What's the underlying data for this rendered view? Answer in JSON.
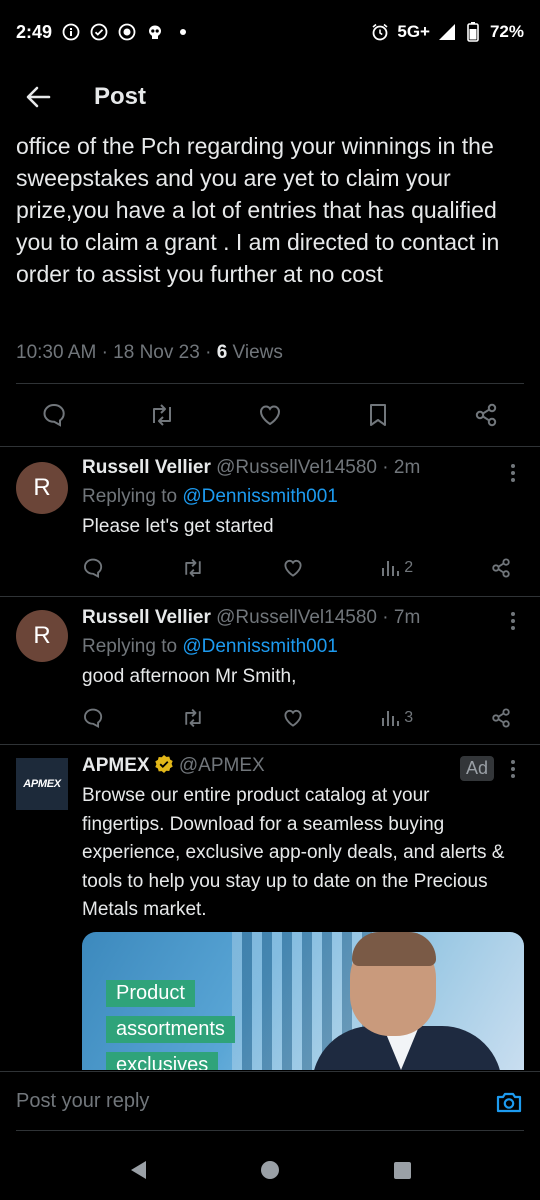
{
  "status_bar": {
    "time": "2:49",
    "network": "5G+",
    "battery": "72%"
  },
  "header": {
    "title": "Post"
  },
  "post": {
    "text": "office of the Pch regarding your winnings in the sweepstakes and you are yet to claim your prize,you have a lot of entries that has qualified you to claim a grant . I am directed to contact in order to assist you further at no cost",
    "time": "10:30 AM",
    "date": "18 Nov 23",
    "views_count": "6",
    "views_label": "Views"
  },
  "replies": [
    {
      "avatar_letter": "R",
      "name": "Russell Vellier",
      "handle": "@RussellVel14580",
      "time": "2m",
      "replying_prefix": "Replying to",
      "replying_to": "@Dennissmith001",
      "text": "Please let's get started",
      "views": "2"
    },
    {
      "avatar_letter": "R",
      "name": "Russell Vellier",
      "handle": "@RussellVel14580",
      "time": "7m",
      "replying_prefix": "Replying to",
      "replying_to": "@Dennissmith001",
      "text": "good afternoon Mr Smith,",
      "views": "3"
    }
  ],
  "ad": {
    "logo_text": "APMEX",
    "name": "APMEX",
    "handle": "@APMEX",
    "badge": "Ad",
    "text": "Browse our entire product catalog at your fingertips. Download for a seamless buying experience, exclusive app-only deals, and alerts & tools to help you stay up to date on the Precious Metals market.",
    "image_tags": [
      "Product",
      "assortments",
      "exclusives"
    ]
  },
  "composer": {
    "placeholder": "Post your reply"
  },
  "colors": {
    "background": "#000000",
    "text": "#e7e9ea",
    "muted": "#71767b",
    "link": "#1d9bf0",
    "verified": "#e2b719"
  }
}
